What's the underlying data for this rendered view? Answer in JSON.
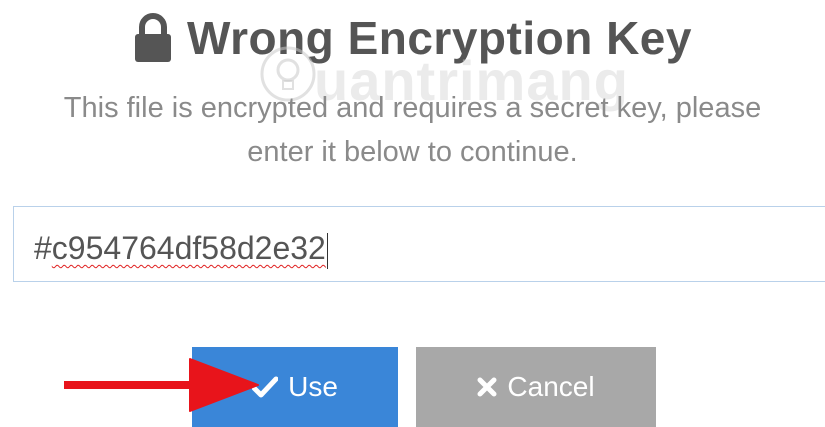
{
  "dialog": {
    "title": "Wrong Encryption Key",
    "message_line1": "This file is encrypted and requires a secret key, please",
    "message_line2": "enter it below to continue.",
    "key_input": {
      "hash": "#",
      "value": "c954764df58d2e32"
    },
    "buttons": {
      "use_label": "Use",
      "cancel_label": "Cancel"
    }
  },
  "watermark": {
    "text": "uantrimang"
  },
  "icons": {
    "title": "lock-icon",
    "use": "check-icon",
    "cancel": "times-icon",
    "annotation": "red-arrow-icon"
  },
  "colors": {
    "title": "#555555",
    "message": "#8a8a8a",
    "use_button": "#3a86d8",
    "cancel_button": "#a8a8a8",
    "input_border": "#b9d1ea",
    "arrow": "#e8141b"
  }
}
